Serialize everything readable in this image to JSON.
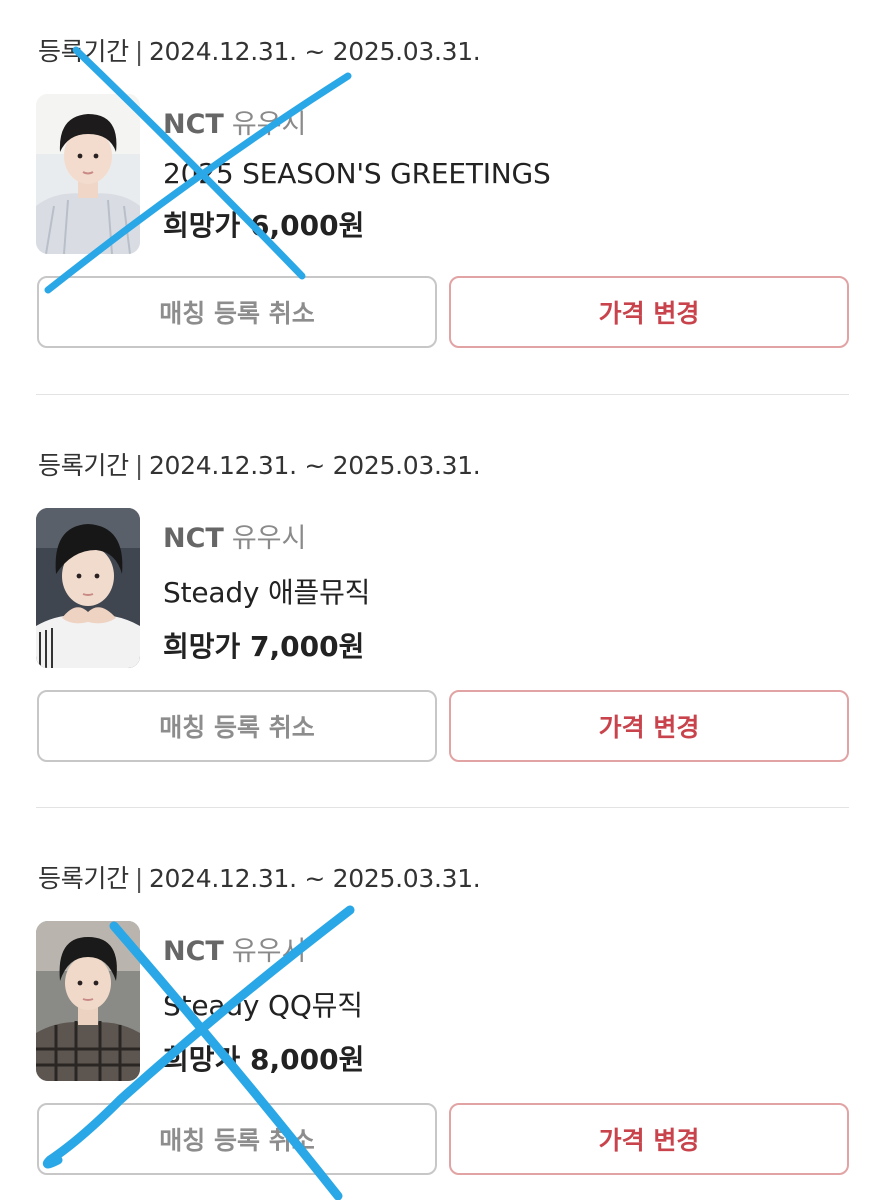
{
  "items": [
    {
      "period_label": "등록기간",
      "period_separator": "|",
      "period_value": "2024.12.31. ~ 2025.03.31.",
      "artist": "NCT",
      "member": "유우시",
      "title": "2025 SEASON'S GREETINGS",
      "price_label": "희망가",
      "price_value": "6,000원",
      "cancel_label": "매칭 등록 취소",
      "change_label": "가격 변경",
      "crossed_out": true
    },
    {
      "period_label": "등록기간",
      "period_separator": "|",
      "period_value": "2024.12.31. ~ 2025.03.31.",
      "artist": "NCT",
      "member": "유우시",
      "title": "Steady 애플뮤직",
      "price_label": "희망가",
      "price_value": "7,000원",
      "cancel_label": "매칭 등록 취소",
      "change_label": "가격 변경",
      "crossed_out": false
    },
    {
      "period_label": "등록기간",
      "period_separator": "|",
      "period_value": "2024.12.31. ~ 2025.03.31.",
      "artist": "NCT",
      "member": "유우시",
      "title": "Steady QQ뮤직",
      "price_label": "희망가",
      "price_value": "8,000원",
      "cancel_label": "매칭 등록 취소",
      "change_label": "가격 변경",
      "crossed_out": true
    }
  ],
  "colors": {
    "cancel_border": "#c7c7c7",
    "cancel_text": "#8d8d8d",
    "change_border": "#e1a3a3",
    "change_text": "#c8434b",
    "cross_mark": "#2aa7e6"
  }
}
